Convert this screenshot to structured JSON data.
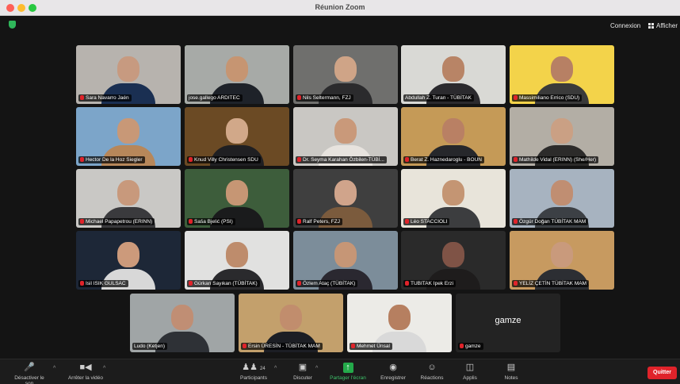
{
  "window": {
    "title": "Réunion Zoom"
  },
  "topbar": {
    "connexion": "Connexion",
    "afficher": "Afficher"
  },
  "participants": [
    {
      "name": "Sara Navarro Jaén",
      "muted": true,
      "bg": "#b7b3ae",
      "skin": "#c79a80",
      "shirt": "#1a2f52"
    },
    {
      "name": "jose.gallego ARDITEC",
      "muted": false,
      "active": true,
      "bg": "#a7aaa7",
      "skin": "#c69572",
      "shirt": "#1e2229"
    },
    {
      "name": "Nils Seltermann, FZJ",
      "muted": true,
      "bg": "#6f6f6d",
      "skin": "#cfa487",
      "shirt": "#2b2b2d"
    },
    {
      "name": "Abdullah Z. Turan - TÜBİTAK",
      "muted": false,
      "bg": "#d9d9d5",
      "skin": "#b88466",
      "shirt": "#2b2a2e"
    },
    {
      "name": "Massimiliano Errico (SDU)",
      "muted": true,
      "bg": "#f3d34a",
      "skin": "#b78064",
      "shirt": "#3a3a3a"
    },
    {
      "name": "Hector De la Hoz Siegler",
      "muted": true,
      "bg": "#7ca5c9",
      "skin": "#c89877",
      "shirt": "#b7875a"
    },
    {
      "name": "Knud Villy Christensen SDU",
      "muted": true,
      "bg": "#6b4a24",
      "skin": "#d1a889",
      "shirt": "#1f1f22"
    },
    {
      "name": "Dr. Seyma Karahan Özbilen-TÜBİ...",
      "muted": true,
      "bg": "#c9c7c3",
      "skin": "#c9997a",
      "shirt": "#e7e3de"
    },
    {
      "name": "Berat Z. Haznedaroglu - BOUN",
      "muted": true,
      "bg": "#c59a57",
      "skin": "#b98064",
      "shirt": "#26272b"
    },
    {
      "name": "Mathilde Vidal (ERINN) (She/Her)",
      "muted": true,
      "bg": "#b3aea5",
      "skin": "#caa084",
      "shirt": "#2c2b2a"
    },
    {
      "name": "Michael Papapetrou (ERINN)",
      "muted": true,
      "bg": "#c9c8c5",
      "skin": "#c8997c",
      "shirt": "#3a3a3d"
    },
    {
      "name": "Saša Bjelić (PSI)",
      "muted": true,
      "bg": "#3d5d3b",
      "skin": "#c69674",
      "shirt": "#1a1b1c"
    },
    {
      "name": "Ralf Peters, FZJ",
      "muted": true,
      "bg": "#3f3f3f",
      "skin": "#d0a48b",
      "shirt": "#7b5b3d"
    },
    {
      "name": "Léo STACCIOLI",
      "muted": true,
      "bg": "#e8e4da",
      "skin": "#c49573",
      "shirt": "#3c3d3f"
    },
    {
      "name": "Özgür Doğan TÜBİTAK MAM",
      "muted": true,
      "bg": "#a7b3c0",
      "skin": "#c08e72",
      "shirt": "#3c4045"
    },
    {
      "name": "Isil ISIK GULSAC",
      "muted": true,
      "bg": "#1d2737",
      "skin": "#cc9a7b",
      "shirt": "#d8d8d8"
    },
    {
      "name": "Gürkan Sayıkan (TÜBİTAK)",
      "muted": true,
      "bg": "#e1e1e0",
      "skin": "#be8c6c",
      "shirt": "#2a2a2d"
    },
    {
      "name": "Özlem Ataç (TÜBİTAK)",
      "muted": true,
      "bg": "#7c8d9a",
      "skin": "#c69676",
      "shirt": "#2a2830"
    },
    {
      "name": "TUBITAK Ipek Erzi",
      "muted": true,
      "bg": "#2a2a2a",
      "skin": "#7f5346",
      "shirt": "#1e1c1c"
    },
    {
      "name": "YELİZ ÇETİN TÜBİTAK MAM",
      "muted": true,
      "bg": "#c79a60",
      "skin": "#c99a7c",
      "shirt": "#2c2e33"
    },
    {
      "name": "Ludo (Ketjen)",
      "muted": false,
      "bg": "#a0a5a6",
      "skin": "#c08e74",
      "shirt": "#2e3136"
    },
    {
      "name": "Ersin ÜRESİN - TÜBİTAK MAM",
      "muted": true,
      "bg": "#c3a06c",
      "skin": "#c18d6d",
      "shirt": "#1c1e24"
    },
    {
      "name": "Mehmet Ünsal",
      "muted": true,
      "bg": "#ecebe7",
      "skin": "#b67f60",
      "shirt": "#d9d9d9"
    },
    {
      "name": "gamze",
      "muted": true,
      "text_only": true,
      "display": "gamze"
    }
  ],
  "toolbar": {
    "mute": "Désactiver le son",
    "video": "Arrêter la vidéo",
    "participants": "Participants",
    "participants_count": "24",
    "chat": "Discuter",
    "share": "Partager l'écran",
    "record": "Enregistrer",
    "reactions": "Réactions",
    "apps": "Applis",
    "notes": "Notes",
    "quit": "Quitter"
  },
  "colors": {
    "mute_red": "#e0232a",
    "active_green": "#58c05a",
    "share_green": "#24a94a"
  }
}
